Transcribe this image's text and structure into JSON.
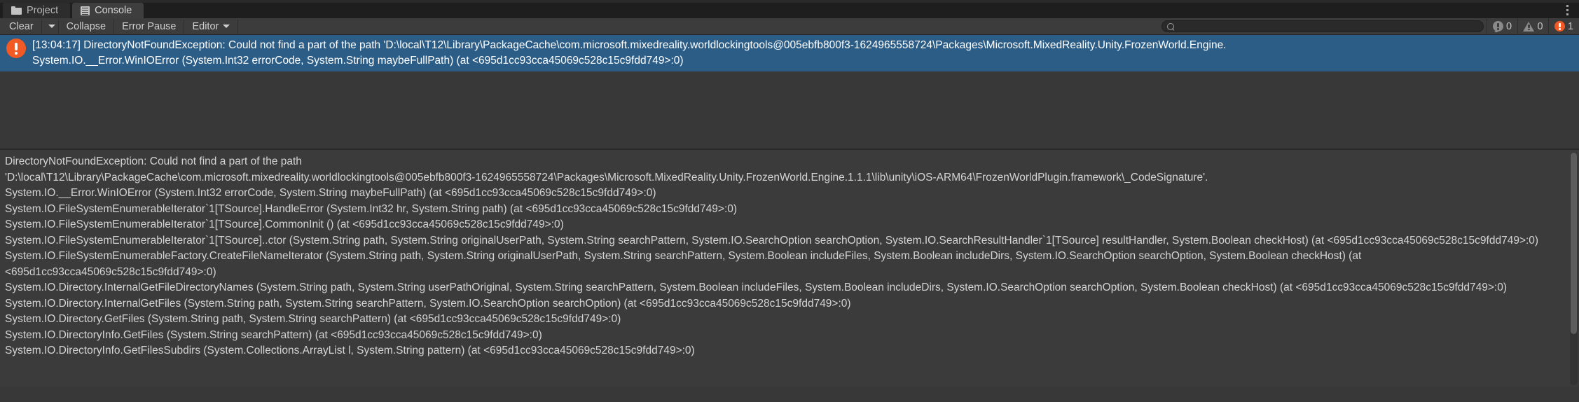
{
  "window": {
    "menu_icon": "kebab-menu-icon",
    "tabs": [
      {
        "label": "Project",
        "icon": "folder-icon",
        "active": false
      },
      {
        "label": "Console",
        "icon": "console-icon",
        "active": true
      }
    ]
  },
  "toolbar": {
    "clear_label": "Clear",
    "clear_dropdown_icon": "chevron-down-icon",
    "collapse_label": "Collapse",
    "error_pause_label": "Error Pause",
    "editor_label": "Editor",
    "editor_dropdown_icon": "chevron-down-icon",
    "search": {
      "icon": "search-icon",
      "value": "",
      "placeholder": ""
    },
    "counters": {
      "info_icon": "info-badge-icon",
      "info_count": "0",
      "warning_icon": "warning-badge-icon",
      "warning_count": "0",
      "error_icon": "error-badge-icon",
      "error_count": "1"
    }
  },
  "log_list": {
    "entries": [
      {
        "severity_icon": "error-circle-icon",
        "selected": true,
        "timestamp": "[13:04:17]",
        "line1": "[13:04:17] DirectoryNotFoundException: Could not find a part of the path 'D:\\local\\T12\\Library\\PackageCache\\com.microsoft.mixedreality.worldlockingtools@005ebfb800f3-1624965558724\\Packages\\Microsoft.MixedReality.Unity.FrozenWorld.Engine.",
        "line2": "System.IO.__Error.WinIOError (System.Int32 errorCode, System.String maybeFullPath) (at <695d1cc93cca45069c528c15c9fdd749>:0)"
      }
    ]
  },
  "detail": {
    "text": "DirectoryNotFoundException: Could not find a part of the path\n'D:\\local\\T12\\Library\\PackageCache\\com.microsoft.mixedreality.worldlockingtools@005ebfb800f3-1624965558724\\Packages\\Microsoft.MixedReality.Unity.FrozenWorld.Engine.1.1.1\\lib\\unity\\iOS-ARM64\\FrozenWorldPlugin.framework\\_CodeSignature'.\nSystem.IO.__Error.WinIOError (System.Int32 errorCode, System.String maybeFullPath) (at <695d1cc93cca45069c528c15c9fdd749>:0)\nSystem.IO.FileSystemEnumerableIterator`1[TSource].HandleError (System.Int32 hr, System.String path) (at <695d1cc93cca45069c528c15c9fdd749>:0)\nSystem.IO.FileSystemEnumerableIterator`1[TSource].CommonInit () (at <695d1cc93cca45069c528c15c9fdd749>:0)\nSystem.IO.FileSystemEnumerableIterator`1[TSource]..ctor (System.String path, System.String originalUserPath, System.String searchPattern, System.IO.SearchOption searchOption, System.IO.SearchResultHandler`1[TSource] resultHandler, System.Boolean checkHost) (at <695d1cc93cca45069c528c15c9fdd749>:0)\nSystem.IO.FileSystemEnumerableFactory.CreateFileNameIterator (System.String path, System.String originalUserPath, System.String searchPattern, System.Boolean includeFiles, System.Boolean includeDirs, System.IO.SearchOption searchOption, System.Boolean checkHost) (at <695d1cc93cca45069c528c15c9fdd749>:0)\nSystem.IO.Directory.InternalGetFileDirectoryNames (System.String path, System.String userPathOriginal, System.String searchPattern, System.Boolean includeFiles, System.Boolean includeDirs, System.IO.SearchOption searchOption, System.Boolean checkHost) (at <695d1cc93cca45069c528c15c9fdd749>:0)\nSystem.IO.Directory.InternalGetFiles (System.String path, System.String searchPattern, System.IO.SearchOption searchOption) (at <695d1cc93cca45069c528c15c9fdd749>:0)\nSystem.IO.Directory.GetFiles (System.String path, System.String searchPattern) (at <695d1cc93cca45069c528c15c9fdd749>:0)\nSystem.IO.DirectoryInfo.GetFiles (System.String searchPattern) (at <695d1cc93cca45069c528c15c9fdd749>:0)\nSystem.IO.DirectoryInfo.GetFilesSubdirs (System.Collections.ArrayList l, System.String pattern) (at <695d1cc93cca45069c528c15c9fdd749>:0)"
  },
  "colors": {
    "selection_blue": "#2c5d87",
    "error_orange": "#f15a24",
    "panel_bg": "#383838",
    "detail_bg": "#3b3b3b",
    "toolbar_bg": "#3c3c3c"
  }
}
